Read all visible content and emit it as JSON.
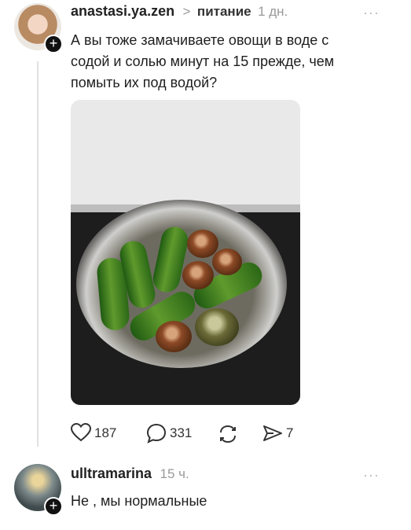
{
  "post": {
    "author": "anastasi.ya.zen",
    "breadcrumb_sep": ">",
    "topic": "питание",
    "time": "1 дн.",
    "menu": "···",
    "text_line1": "А вы тоже замачиваете овощи в воде с",
    "text_line2": "содой и солью минут на 15 прежде, чем",
    "text_line3": "помыть их под водой?",
    "photo_desc": "cucumbers and tomatoes soaking in a bowl of water",
    "likes": "187",
    "comments": "331",
    "shares": "7"
  },
  "reply": {
    "author": "ulltramarina",
    "time": "15 ч.",
    "menu": "···",
    "text": "Не , мы нормальные"
  },
  "icons": {
    "follow": "plus-icon",
    "like": "heart-icon",
    "comment": "speech-bubble-icon",
    "repost": "repost-icon",
    "share": "send-icon"
  }
}
